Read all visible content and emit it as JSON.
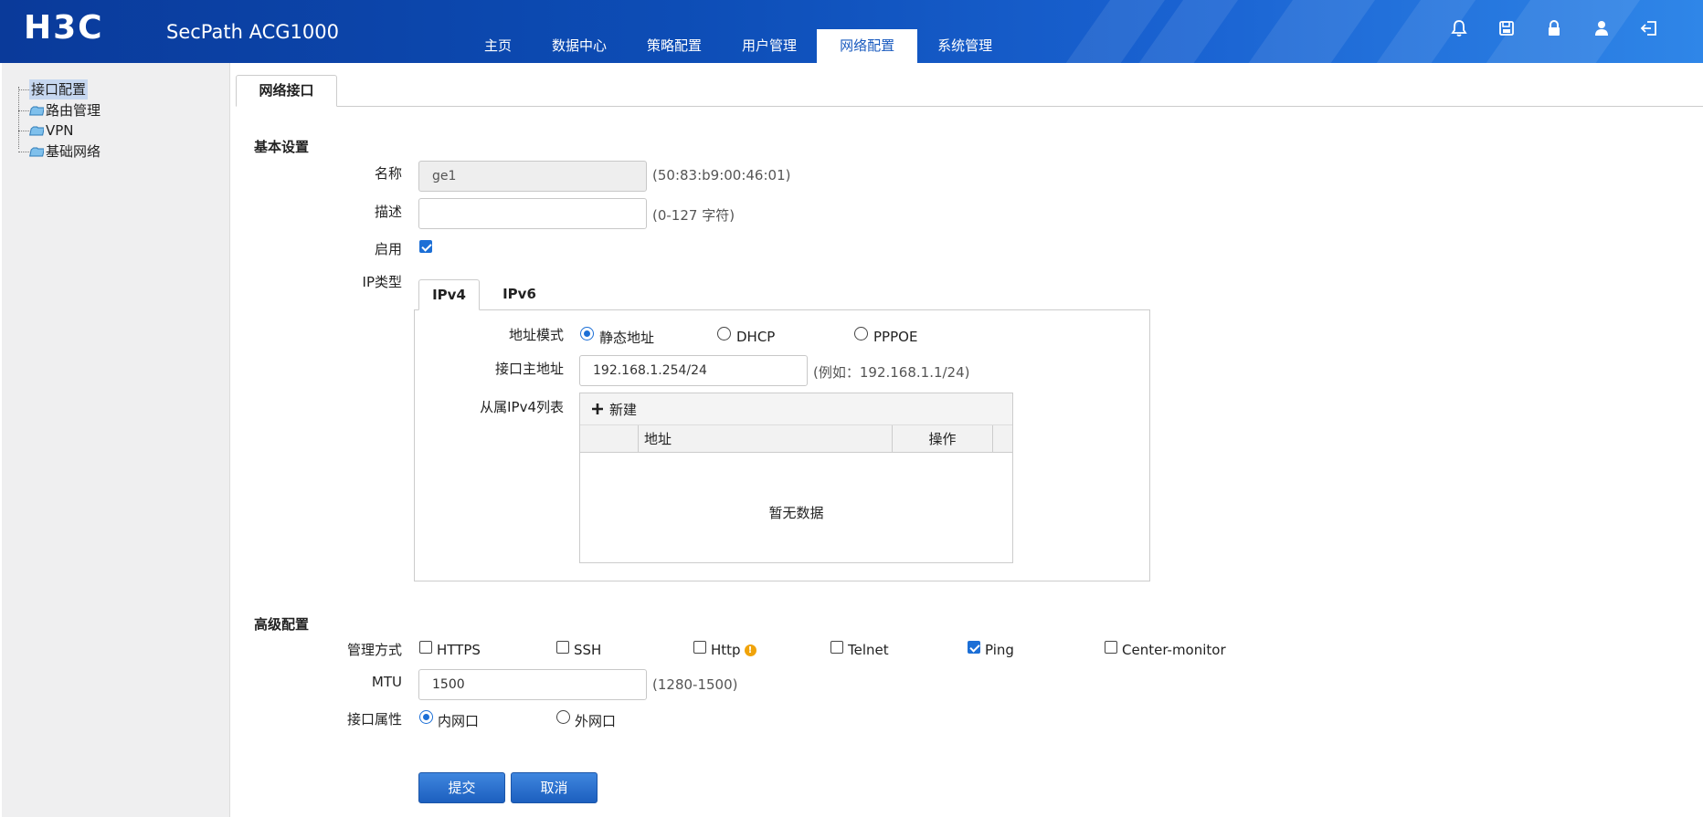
{
  "header": {
    "logo_text": "H3C",
    "product": "SecPath ACG1000",
    "nav": [
      "主页",
      "数据中心",
      "策略配置",
      "用户管理",
      "网络配置",
      "系统管理"
    ],
    "active_nav": "网络配置",
    "icons": [
      "bell-icon",
      "save-icon",
      "lock-icon",
      "user-icon",
      "logout-icon"
    ]
  },
  "sidebar": {
    "items": [
      "接口配置",
      "路由管理",
      "VPN",
      "基础网络"
    ],
    "selected": "接口配置"
  },
  "content": {
    "tab": "网络接口",
    "basic": {
      "title": "基本设置",
      "name_label": "名称",
      "name_value": "ge1",
      "mac_hint": "(50:83:b9:00:46:01)",
      "desc_label": "描述",
      "desc_value": "",
      "desc_hint": "(0-127 字符)",
      "enable_label": "启用",
      "enable_checked": true,
      "iptype_label": "IP类型",
      "iptabs": [
        "IPv4",
        "IPv6"
      ],
      "addr_mode_label": "地址模式",
      "addr_modes": [
        "静态地址",
        "DHCP",
        "PPPOE"
      ],
      "addr_mode_selected": "静态地址",
      "primary_label": "接口主地址",
      "primary_value": "192.168.1.254/24",
      "primary_hint": "(例如：192.168.1.1/24)",
      "secondary_label": "从属IPv4列表",
      "new_label": "新建",
      "col_address": "地址",
      "col_action": "操作",
      "empty_text": "暂无数据"
    },
    "advanced": {
      "title": "高级配置",
      "mgmt_label": "管理方式",
      "mgmt_options": [
        {
          "label": "HTTPS",
          "checked": false
        },
        {
          "label": "SSH",
          "checked": false
        },
        {
          "label": "Http",
          "checked": false
        },
        {
          "label": "Telnet",
          "checked": false
        },
        {
          "label": "Ping",
          "checked": true
        },
        {
          "label": "Center-monitor",
          "checked": false
        }
      ],
      "mtu_label": "MTU",
      "mtu_value": "1500",
      "mtu_hint": "(1280-1500)",
      "attr_label": "接口属性",
      "attr_options": [
        "内网口",
        "外网口"
      ],
      "attr_selected": "内网口"
    },
    "submit_label": "提交",
    "cancel_label": "取消"
  },
  "colors": {
    "header_start": "#0a3a9a",
    "header_end": "#2f86e8",
    "accent": "#1c6fd6",
    "sidebar_bg": "#efeff0"
  }
}
